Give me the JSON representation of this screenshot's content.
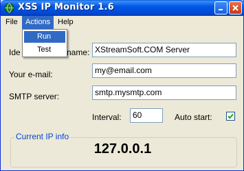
{
  "window": {
    "title": "XSS IP Monitor 1.6"
  },
  "menu": {
    "file": "File",
    "actions": "Actions",
    "help": "Help"
  },
  "actions_menu": {
    "items": [
      "Run",
      "Test"
    ]
  },
  "form": {
    "identity_label_left": "Ide",
    "identity_label_right": "name:",
    "identity_value": "XStreamSoft.COM Server",
    "email_label": "Your e-mail:",
    "email_value": "my@email.com",
    "smtp_label": "SMTP server:",
    "smtp_value": "smtp.mysmtp.com",
    "interval_label": "Interval:",
    "interval_value": "60",
    "autostart_label": "Auto start:",
    "autostart_checked": true
  },
  "ip_group": {
    "caption": "Current IP info",
    "ip": "127.0.0.1"
  },
  "colors": {
    "title_bar": "#0058e6",
    "menu_highlight": "#316ac5",
    "group_caption": "#0046d5",
    "check": "#21a121"
  }
}
